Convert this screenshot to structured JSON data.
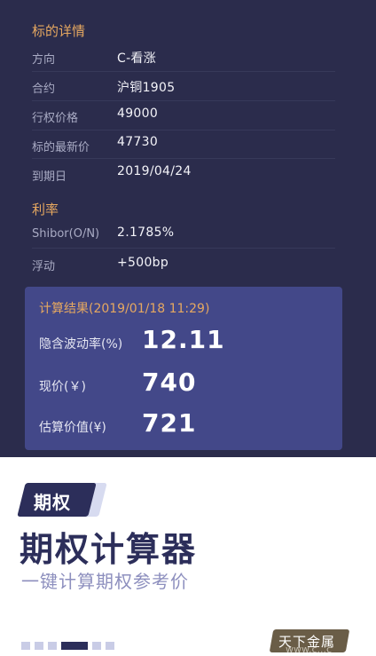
{
  "details": {
    "title": "标的详情",
    "rows": [
      {
        "label": "方向",
        "value": "C-看涨"
      },
      {
        "label": "合约",
        "value": "沪铜1905"
      },
      {
        "label": "行权价格",
        "value": "49000"
      },
      {
        "label": "标的最新价",
        "value": "47730"
      },
      {
        "label": "到期日",
        "value": "2019/04/24"
      }
    ]
  },
  "rate": {
    "title": "利率",
    "rows": [
      {
        "label": "Shibor(O/N)",
        "value": "2.1785%"
      },
      {
        "label": "浮动",
        "value": "+500bp"
      }
    ]
  },
  "result": {
    "title": "计算结果(2019/01/18 11:29)",
    "rows": [
      {
        "label": "隐含波动率(%)",
        "value": "12.11"
      },
      {
        "label": "现价(￥)",
        "value": "740"
      },
      {
        "label": "估算价值(¥)",
        "value": "721"
      }
    ]
  },
  "promo": {
    "badge": "期权",
    "headline": "期权计算器",
    "subline": "一键计算期权参考价",
    "pagination": {
      "count": 6,
      "active_index": 3
    }
  },
  "watermark": {
    "text": "天下金属",
    "sub": "www.c...c"
  },
  "colors": {
    "dark_bg": "#2b2c4c",
    "card_bg": "#434889",
    "accent": "#e6a860",
    "brand": "#2c2e5a"
  }
}
